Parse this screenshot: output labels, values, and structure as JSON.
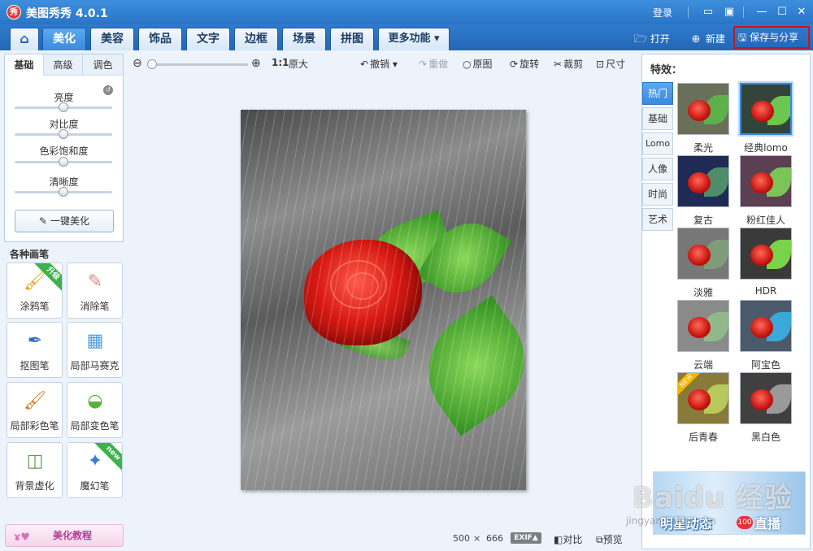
{
  "window": {
    "title": "美图秀秀 4.0.1",
    "logo_text": "秀",
    "login": "登录",
    "controls": [
      "▭",
      "▣",
      "—",
      "☐",
      "✕"
    ]
  },
  "tabs": [
    {
      "label": "⌂"
    },
    {
      "label": "美化"
    },
    {
      "label": "美容"
    },
    {
      "label": "饰品"
    },
    {
      "label": "文字"
    },
    {
      "label": "边框"
    },
    {
      "label": "场景"
    },
    {
      "label": "拼图"
    },
    {
      "label": "更多功能 ▾"
    }
  ],
  "top_actions": {
    "open": "打开",
    "new": "新建",
    "save_share": "保存与分享"
  },
  "left_panel": {
    "sub_tabs": [
      "基础",
      "高级",
      "调色"
    ],
    "sliders": [
      {
        "label": "亮度",
        "value": 0.5
      },
      {
        "label": "对比度",
        "value": 0.5
      },
      {
        "label": "色彩饱和度",
        "value": 0.5
      },
      {
        "label": "清晰度",
        "value": 0.5
      }
    ],
    "one_click": "一键美化"
  },
  "brushes": {
    "title": "各种画笔",
    "items": [
      {
        "label": "涂鸦笔",
        "icon": "🖌",
        "badge": "升级"
      },
      {
        "label": "消除笔",
        "icon": "✎",
        "badge": ""
      },
      {
        "label": "抠图笔",
        "icon": "✒",
        "badge": ""
      },
      {
        "label": "局部马赛克",
        "icon": "▦",
        "badge": ""
      },
      {
        "label": "局部彩色笔",
        "icon": "🖌",
        "badge": ""
      },
      {
        "label": "局部变色笔",
        "icon": "◒",
        "badge": ""
      },
      {
        "label": "背景虚化",
        "icon": "◫",
        "badge": ""
      },
      {
        "label": "魔幻笔",
        "icon": "✦",
        "badge": "new"
      }
    ]
  },
  "tutorial": "美化教程",
  "toolbar": {
    "zoom_value": 0,
    "ratio": "1:1",
    "original_size": "原大",
    "undo": "撤销",
    "redo": "重做",
    "original": "原图",
    "rotate": "旋转",
    "crop": "裁剪",
    "size": "尺寸"
  },
  "status": {
    "width": "500",
    "times": "×",
    "height": "666",
    "exif": "EXIF▲",
    "compare": "对比",
    "preview": "预览"
  },
  "effects": {
    "title": "特效：",
    "categories": [
      "热门",
      "基础",
      "Lomo",
      "人像",
      "时尚",
      "艺术"
    ],
    "items": [
      {
        "label": "柔光",
        "tint": "#6a6f5a",
        "leaf": "#5fb04a"
      },
      {
        "label": "经典lomo",
        "tint": "#33453a",
        "leaf": "#6cc650"
      },
      {
        "label": "复古",
        "tint": "#1f2a55",
        "leaf": "#4f8c6a"
      },
      {
        "label": "粉红佳人",
        "tint": "#5a4050",
        "leaf": "#7ac45a"
      },
      {
        "label": "淡雅",
        "tint": "#777777",
        "leaf": "#7f9c7a"
      },
      {
        "label": "HDR",
        "tint": "#3a3a3a",
        "leaf": "#78d24a"
      },
      {
        "label": "云端",
        "tint": "#8a8a8a",
        "leaf": "#90b88a"
      },
      {
        "label": "阿宝色",
        "tint": "#4a5a6a",
        "leaf": "#3aa8d8"
      },
      {
        "label": "后青春",
        "tint": "#8a7a3a",
        "leaf": "#b8c85a",
        "badge": "NEW"
      },
      {
        "label": "黑白色",
        "tint": "#404040",
        "leaf": "#9a9a9a"
      }
    ]
  },
  "ad": {
    "text": "明星动态",
    "badge": "100",
    "live": "直播"
  },
  "watermark": {
    "main": "Baidu 经验",
    "sub": "jingyan.baidu.com"
  }
}
